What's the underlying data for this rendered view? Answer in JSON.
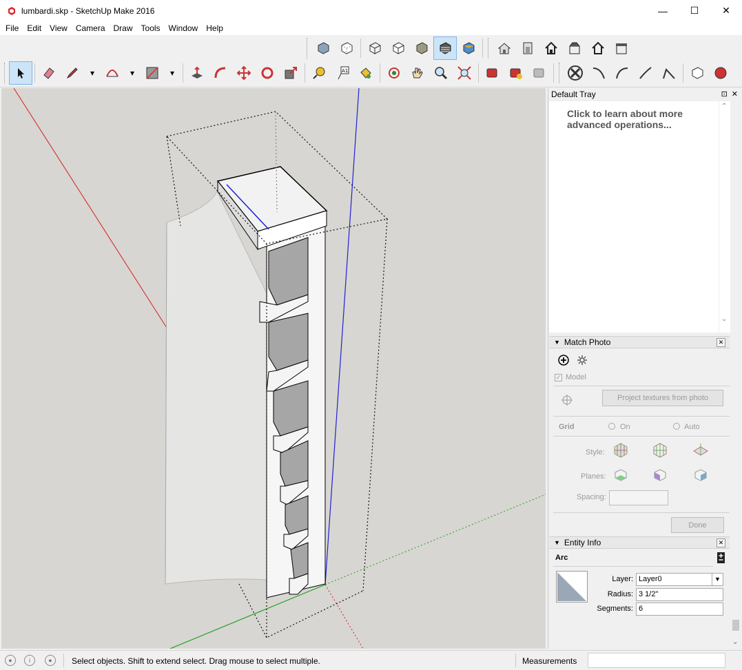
{
  "window": {
    "title": "lumbardi.skp - SketchUp Make 2016",
    "minimize": "—",
    "maximize": "☐",
    "close": "✕"
  },
  "menu": [
    "File",
    "Edit",
    "View",
    "Camera",
    "Draw",
    "Tools",
    "Window",
    "Help"
  ],
  "toolbar": {
    "views": [
      "iso-view-icon",
      "top-view-icon",
      "front-view-icon",
      "right-view-icon",
      "back-view-icon",
      "left-view-icon",
      "bottom-view-icon"
    ],
    "styles": [
      "xray-icon",
      "back-edges-icon",
      "wireframe-icon",
      "hidden-line-icon",
      "shaded-icon",
      "shaded-textures-icon",
      "monochrome-icon"
    ],
    "warehouse": [
      "warehouse-icon",
      "share-model-icon",
      "component-warehouse-icon",
      "extension-warehouse-icon",
      "share-component-icon",
      "get-models-icon"
    ],
    "main": [
      "select-icon",
      "eraser-icon",
      "pencil-icon",
      "arc-icon",
      "rectangle-icon",
      "push-pull-icon",
      "follow-me-icon",
      "move-icon",
      "rotate-icon",
      "scale-icon",
      "tape-measure-icon",
      "text-icon",
      "paint-bucket-icon",
      "orbit-icon",
      "pan-icon",
      "zoom-icon",
      "zoom-extents-icon",
      "trimble-connect-icon",
      "add-location-icon",
      "layout-icon",
      "solid-tools-icon",
      "bezier-icon",
      "curve-icon",
      "spline-icon",
      "polyline-icon",
      "box-icon",
      "sandbox-icon"
    ]
  },
  "tray": {
    "title": "Default Tray",
    "pin": "⊡",
    "close": "✕",
    "instructor_text": "Click to learn about more advanced operations..."
  },
  "match_photo": {
    "title": "Match Photo",
    "model_label": "Model",
    "project_button": "Project textures from photo",
    "grid_label": "Grid",
    "on_label": "On",
    "auto_label": "Auto",
    "style_label": "Style:",
    "planes_label": "Planes:",
    "spacing_label": "Spacing:",
    "done_button": "Done"
  },
  "entity_info": {
    "title": "Entity Info",
    "entity_type": "Arc",
    "layer_label": "Layer:",
    "layer_value": "Layer0",
    "radius_label": "Radius:",
    "radius_value": "3 1/2\"",
    "segments_label": "Segments:",
    "segments_value": "6"
  },
  "status": {
    "message": "Select objects. Shift to extend select. Drag mouse to select multiple.",
    "measurements_label": "Measurements",
    "measurements_value": ""
  },
  "colors": {
    "viewport_bg": "#d7d6d2",
    "axis_red": "#d41f1f",
    "axis_green": "#1fa11f",
    "axis_blue": "#1f1fd4",
    "selection_blue": "#1f1fd4"
  }
}
